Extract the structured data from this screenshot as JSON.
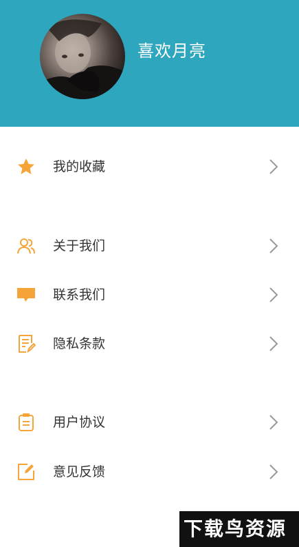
{
  "profile": {
    "username": "喜欢月亮"
  },
  "menu": {
    "favorites": {
      "label": "我的收藏",
      "icon": "star-icon"
    },
    "about": {
      "label": "关于我们",
      "icon": "users-icon"
    },
    "contact": {
      "label": "联系我们",
      "icon": "chat-icon"
    },
    "privacy": {
      "label": "隐私条款",
      "icon": "document-edit-icon"
    },
    "agreement": {
      "label": "用户协议",
      "icon": "clipboard-icon"
    },
    "feedback": {
      "label": "意见反馈",
      "icon": "edit-square-icon"
    }
  },
  "watermark": {
    "text": "下载鸟资源"
  },
  "colors": {
    "header": "#2ea6be",
    "accent": "#f5a43a",
    "chevron": "#999999"
  }
}
